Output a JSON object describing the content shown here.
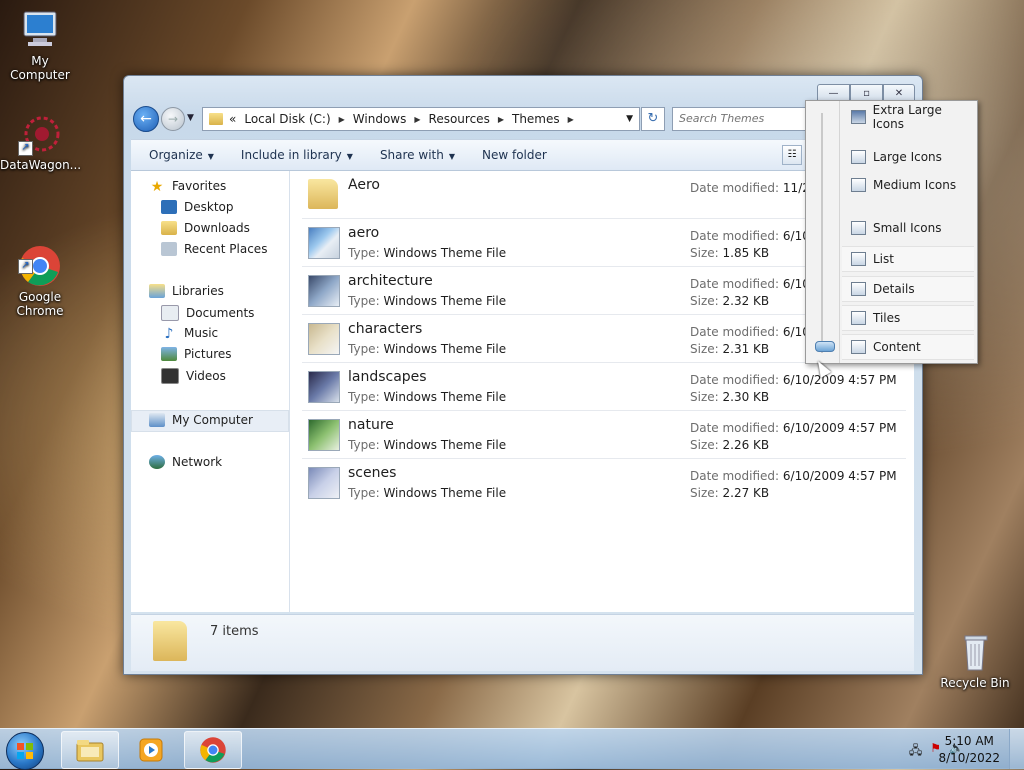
{
  "desktop": {
    "icons": [
      {
        "label": "My Computer",
        "icon": "computer-icon"
      },
      {
        "label": "DataWagon...",
        "icon": "datawagon-icon"
      },
      {
        "label": "Google\nChrome",
        "icon": "chrome-icon"
      },
      {
        "label": "Recycle Bin",
        "icon": "recycle-bin-icon"
      }
    ]
  },
  "window": {
    "caption_buttons": {
      "minimize": "—",
      "maximize": "▫",
      "close": "✕"
    },
    "nav": {
      "back": "←",
      "forward": "→",
      "history_drop": "▼"
    },
    "address": {
      "prefix": "«",
      "crumbs": [
        "Local Disk (C:)",
        "Windows",
        "Resources",
        "Themes"
      ],
      "separator": "▶",
      "drop": "▼"
    },
    "refresh": "↻",
    "search": {
      "placeholder": "Search Themes"
    },
    "toolbar": {
      "organize": "Organize",
      "include": "Include in library",
      "share": "Share with",
      "new_folder": "New folder",
      "caret": "▼"
    },
    "navpane": {
      "favorites": {
        "label": "Favorites",
        "items": [
          "Desktop",
          "Downloads",
          "Recent Places"
        ]
      },
      "libraries": {
        "label": "Libraries",
        "items": [
          "Documents",
          "Music",
          "Pictures",
          "Videos"
        ]
      },
      "computer": "My Computer",
      "network": "Network"
    },
    "files": [
      {
        "name": "Aero",
        "type_label": "",
        "type": "",
        "date_label": "Date modified:",
        "date": "11/20/",
        "size_label": "",
        "size": "",
        "kind": "folder"
      },
      {
        "name": "aero",
        "type_label": "Type:",
        "type": "Windows Theme File",
        "date_label": "Date modified:",
        "date": "6/10/2",
        "size_label": "Size:",
        "size": "1.85 KB",
        "kind": "theme"
      },
      {
        "name": "architecture",
        "type_label": "Type:",
        "type": "Windows Theme File",
        "date_label": "Date modified:",
        "date": "6/10/2",
        "size_label": "Size:",
        "size": "2.32 KB",
        "kind": "theme"
      },
      {
        "name": "characters",
        "type_label": "Type:",
        "type": "Windows Theme File",
        "date_label": "Date modified:",
        "date": "6/10/2",
        "size_label": "Size:",
        "size": "2.31 KB",
        "kind": "theme"
      },
      {
        "name": "landscapes",
        "type_label": "Type:",
        "type": "Windows Theme File",
        "date_label": "Date modified:",
        "date": "6/10/2009 4:57 PM",
        "size_label": "Size:",
        "size": "2.30 KB",
        "kind": "theme"
      },
      {
        "name": "nature",
        "type_label": "Type:",
        "type": "Windows Theme File",
        "date_label": "Date modified:",
        "date": "6/10/2009 4:57 PM",
        "size_label": "Size:",
        "size": "2.26 KB",
        "kind": "theme"
      },
      {
        "name": "scenes",
        "type_label": "Type:",
        "type": "Windows Theme File",
        "date_label": "Date modified:",
        "date": "6/10/2009 4:57 PM",
        "size_label": "Size:",
        "size": "2.27 KB",
        "kind": "theme"
      }
    ],
    "details": {
      "count": "7 items"
    }
  },
  "view_menu": {
    "items": [
      {
        "label": "Extra Large Icons",
        "id": "extra-large-icons"
      },
      {
        "label": "Large Icons",
        "id": "large-icons"
      },
      {
        "label": "Medium Icons",
        "id": "medium-icons"
      },
      {
        "label": "Small Icons",
        "id": "small-icons"
      },
      {
        "label": "List",
        "id": "list"
      },
      {
        "label": "Details",
        "id": "details"
      },
      {
        "label": "Tiles",
        "id": "tiles"
      },
      {
        "label": "Content",
        "id": "content"
      }
    ],
    "selected": "Content"
  },
  "taskbar": {
    "clock_time": "5:10 AM",
    "clock_date": "8/10/2022"
  },
  "colors": {
    "accent": "#1f5fb5",
    "selection": "#e8eef6"
  }
}
